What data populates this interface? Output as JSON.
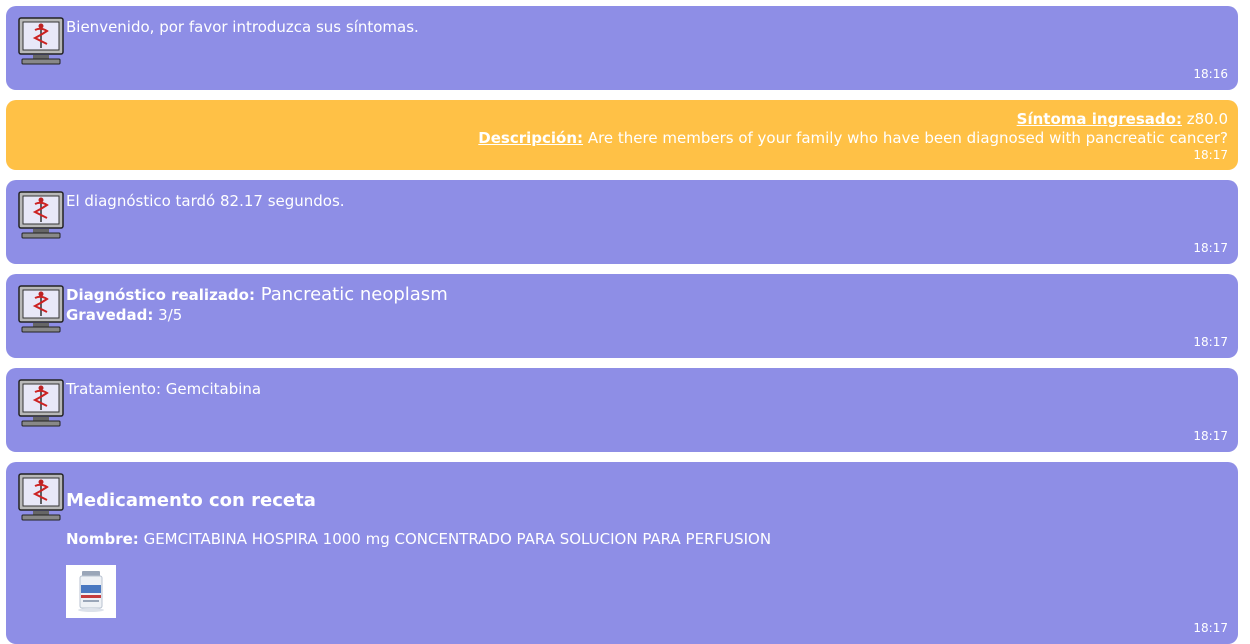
{
  "messages": {
    "welcome": {
      "text": "Bienvenido, por favor introduzca sus síntomas.",
      "time": "18:16"
    },
    "symptom": {
      "symptom_label": "Síntoma ingresado:",
      "symptom_value": " z80.0",
      "desc_label": "Descripción:",
      "desc_value": " Are there members of your family who have been diagnosed with pancreatic cancer?",
      "time": "18:17"
    },
    "duration": {
      "text": "El diagnóstico tardó 82.17 segundos.",
      "time": "18:17"
    },
    "diagnosis": {
      "dx_label": "Diagnóstico realizado:",
      "dx_value": " Pancreatic neoplasm",
      "sev_label": "Gravedad:",
      "sev_value": " 3/5",
      "time": "18:17"
    },
    "treatment": {
      "text": "Tratamiento: Gemcitabina",
      "time": "18:17"
    },
    "prescription": {
      "title": "Medicamento con receta",
      "name_label": "Nombre:",
      "name_value": " GEMCITABINA HOSPIRA 1000 mg CONCENTRADO PARA SOLUCION PARA PERFUSION",
      "time": "18:17"
    }
  },
  "colors": {
    "bot_bubble": "#8e8ee6",
    "user_bubble": "#ffc146"
  },
  "icons": {
    "bot_avatar": "medical-computer-icon",
    "product": "medicine-vial-image"
  }
}
